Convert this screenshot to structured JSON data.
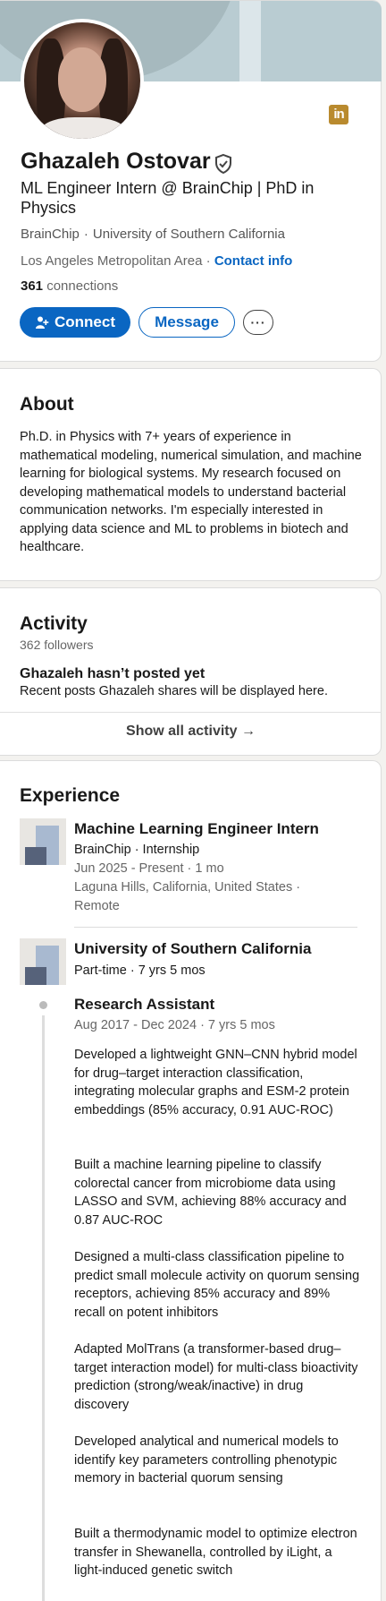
{
  "profile": {
    "name": "Ghazaleh Ostovar",
    "headline": "ML Engineer Intern @ BrainChip | PhD in Physics",
    "org_company": "BrainChip",
    "org_dot": "·",
    "org_school": "University of Southern California",
    "location": "Los Angeles Metropolitan Area ·",
    "contact_info": "Contact info",
    "connections_count": "361",
    "connections_label": "connections",
    "buttons": {
      "connect": "Connect",
      "message": "Message",
      "more": "···"
    },
    "brand_color": "#0a66c2"
  },
  "about": {
    "title": "About",
    "text": "Ph.D. in Physics with 7+ years of experience in mathematical modeling, numerical simulation, and machine learning for biological systems. My research focused on developing mathematical models to understand bacterial communication networks. I'm especially interested in applying data science and ML to problems in biotech and healthcare."
  },
  "activity": {
    "title": "Activity",
    "followers": "362 followers",
    "no_posts": "Ghazaleh hasn’t posted yet",
    "recent": "Recent posts Ghazaleh shares will be displayed here.",
    "show_all": "Show all activity →"
  },
  "experience": {
    "title": "Experience",
    "job1": {
      "title": "Machine Learning Engineer Intern",
      "company": "BrainChip · Internship",
      "dates": "Jun 2025 - Present · 1 mo",
      "location": "Laguna Hills, California, United States · Remote"
    },
    "job2": {
      "company": "University of Southern California",
      "type": "Part-time · 7 yrs 5 mos",
      "role": "Research Assistant",
      "dates": "Aug 2017 - Dec 2024 · 7 yrs 5 mos",
      "bullets": [
        "Developed a lightweight GNN–CNN hybrid model for drug–target interaction classification, integrating molecular graphs and ESM-2 protein embeddings (85% accuracy, 0.91 AUC-ROC)",
        "Built a machine learning pipeline to classify colorectal cancer from microbiome data using LASSO and SVM, achieving 88% accuracy and 0.87 AUC-ROC",
        "Designed a multi-class classification pipeline to predict small molecule activity on quorum sensing receptors, achieving 85% accuracy and 89% recall on potent inhibitors",
        "Adapted MolTrans (a transformer-based drug–target interaction model) for multi-class bioactivity prediction (strong/weak/inactive) in drug discovery",
        "Developed analytical and numerical models to identify key parameters controlling phenotypic memory in bacterial quorum sensing",
        "Built a thermodynamic model to optimize electron transfer in Shewanella, controlled by iLight, a light-induced genetic switch"
      ]
    }
  },
  "icons": [
    "linkedin-icon",
    "verified-shield-icon",
    "add-person-icon",
    "more-icon",
    "arrow-right-icon"
  ]
}
